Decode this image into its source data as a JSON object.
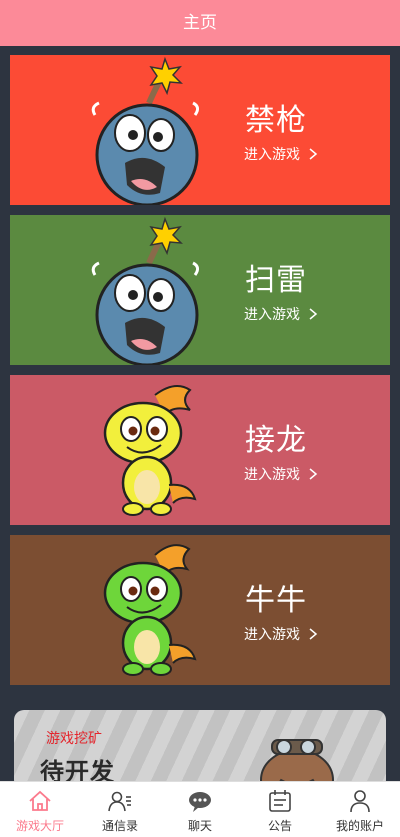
{
  "header": {
    "title": "主页"
  },
  "games": [
    {
      "title": "禁枪",
      "enter": "进入游戏",
      "bg": "#fc4b35"
    },
    {
      "title": "扫雷",
      "enter": "进入游戏",
      "bg": "#5b8a40"
    },
    {
      "title": "接龙",
      "enter": "进入游戏",
      "bg": "#cb5a66"
    },
    {
      "title": "牛牛",
      "enter": "进入游戏",
      "bg": "#7c4e32"
    }
  ],
  "banner": {
    "title": "游戏挖矿",
    "subtitle": "待开发"
  },
  "tabbar": {
    "items": [
      {
        "label": "游戏大厅",
        "icon": "home-icon",
        "active": true
      },
      {
        "label": "通信录",
        "icon": "contacts-icon",
        "active": false
      },
      {
        "label": "聊天",
        "icon": "chat-icon",
        "active": false
      },
      {
        "label": "公告",
        "icon": "notice-icon",
        "active": false
      },
      {
        "label": "我的账户",
        "icon": "user-icon",
        "active": false
      }
    ],
    "active_color": "#fb7a8c"
  },
  "colors": {
    "header": "#fc8a98",
    "page_bg": "#2d3440"
  }
}
